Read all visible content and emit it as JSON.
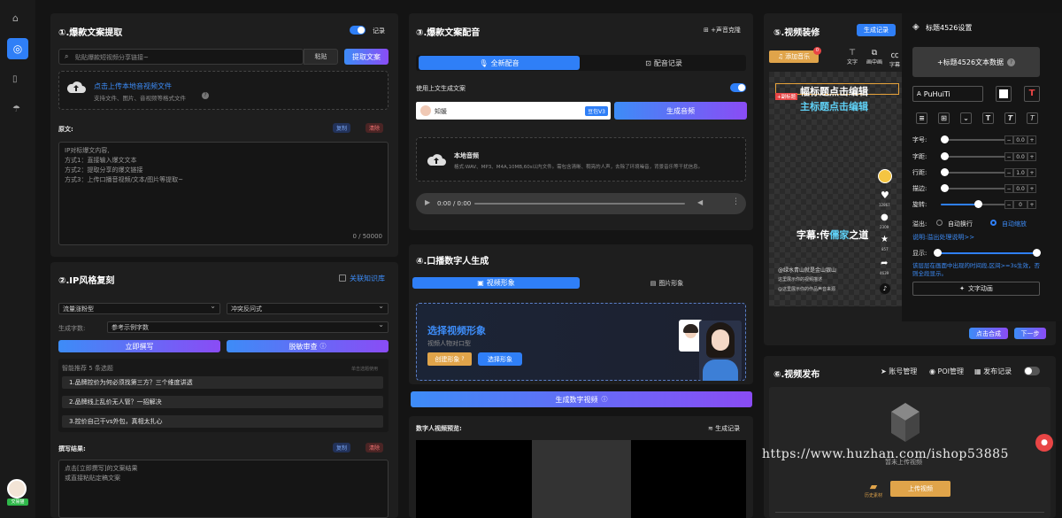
{
  "sidebar": {
    "avatar_badge": "交易猫"
  },
  "p1": {
    "title": "①.爆款文案提取",
    "record_label": "记录",
    "link_placeholder": "贴贴爆款短视频分享链接~",
    "paste_label": "粘贴",
    "extract_label": "提取文案",
    "upload_title": "点击上传本地音视频文件",
    "upload_sub": "支持文件、图片、音视频等格式文件",
    "original_label": "原文:",
    "copy_label": "复制",
    "clear_label": "清除",
    "textarea_lines": [
      "IP对标爆文内容,",
      "方式1：直接输入爆文文本",
      "方式2：提取分享的爆文链接",
      "方式3：上传口播音视频/文本/图片等提取~"
    ],
    "counter": "0 / 50000"
  },
  "p2": {
    "title": "②.IP风格复刻",
    "knowledge_label": "关联知识库",
    "select1": "流量涨粉型",
    "select2": "冲突反问式",
    "count_label": "生成字数:",
    "count_value": "参考示例字数",
    "rewrite_label": "立即撰写",
    "review_label": "脱敏审查",
    "recommend_label": "智能推荐 5 条选题",
    "recommend_right": "单击选题使用",
    "topics": [
      "1.品牌控价为何必须找第三方？三个维度讲透",
      "2.品牌线上乱价无人管？一招解决",
      "3.控价自己干vs外包，真相太扎心"
    ],
    "result_label": "撰写结果:",
    "copy_label": "复制",
    "clear_label": "清除",
    "result_lines": [
      "点击[立即撰写]的文案结果",
      "或直接粘贴定稿文案"
    ]
  },
  "p3": {
    "title": "③.爆款文案配音",
    "clone_label": "+声音克隆",
    "tab_new": "全新配音",
    "tab_record": "配音记录",
    "use_above": "使用上文生成文案",
    "voice_name": "知媛",
    "voice_tag": "豆包V3",
    "gen_audio": "生成音频",
    "local_title": "本地音频",
    "local_sub": "格式:WAV、MP3、M4A,10MB,60s以内文件。需包含清晰、稠亮的人声，去除了环境噪音，背景音乐等干扰信息。",
    "time": "0:00 / 0:00"
  },
  "p4": {
    "title": "④.口播数字人生成",
    "tab_video": "视频形象",
    "tab_image": "图片形象",
    "select_title": "选择视频形象",
    "select_sub": "视频人物对口型",
    "create_label": "创建形象",
    "choose_label": "选择形象",
    "gen_label": "生成数字视频",
    "preview_label": "数字人视频预览:",
    "record_label": "生成记录"
  },
  "p5": {
    "title": "⑤.视频装修",
    "gen_record": "生成记录",
    "add_music": "添加音乐",
    "music_badge": "0",
    "tools": [
      "文字",
      "画中画",
      "字幕"
    ],
    "headline1": "幅标题点击编辑",
    "headline2": "主标题点击编辑",
    "tag_label": "+副标题",
    "subtitle_pre": "字幕:传",
    "subtitle_hl": "儒家",
    "subtitle_post": "之道",
    "side_counts": [
      "12867",
      "2309",
      "857",
      "4639"
    ],
    "caption_lines": [
      "@绿水青山就是金山银山",
      "这里展示你的视频描述",
      "@这里展示你的作品声音来源"
    ],
    "compose_label": "点击合成",
    "next_label": "下一步"
  },
  "settings": {
    "title": "标题4526设置",
    "add_label": "+标题4526文本数据",
    "font_name": "PuHuiTi",
    "rows": [
      {
        "label": "字号:",
        "value": "0.0"
      },
      {
        "label": "字距:",
        "value": "0.0"
      },
      {
        "label": "行距:",
        "value": "1.0"
      },
      {
        "label": "描边:",
        "value": "0.0"
      },
      {
        "label": "旋转:",
        "value": "0"
      }
    ],
    "overflow_label": "溢出:",
    "opt_wrap": "自动换行",
    "opt_scale": "自动缩放",
    "overflow_link": "说明:溢出处理说明>>",
    "show_label": "显示:",
    "hint": "该层层在画面中出现的时间段,区间>=3s生效，否则全段显示。",
    "anim_label": "文字动画"
  },
  "p6": {
    "title": "⑥.视频发布",
    "account": "账号管理",
    "poi": "POI管理",
    "publish_record": "发布记录",
    "empty": "暂未上传视频",
    "history": "历史素材",
    "upload": "上传视频"
  },
  "watermark": "https://www.huzhan.com/ishop53885"
}
